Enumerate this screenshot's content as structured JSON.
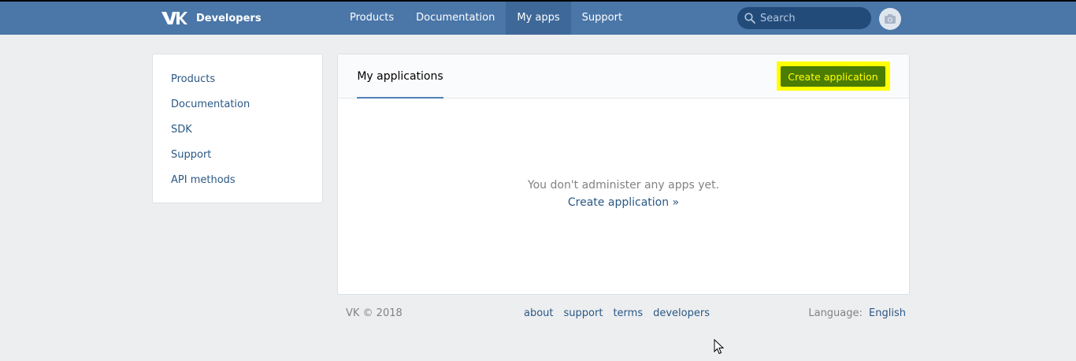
{
  "header": {
    "logo_text": "Developers",
    "nav": [
      "Products",
      "Documentation",
      "My apps",
      "Support"
    ],
    "active_nav": "My apps",
    "search_placeholder": "Search"
  },
  "sidebar": {
    "items": [
      "Products",
      "Documentation",
      "SDK",
      "Support",
      "API methods"
    ]
  },
  "main": {
    "tab_label": "My applications",
    "create_button": "Create application",
    "empty_message": "You don't administer any apps yet.",
    "empty_link": "Create application »"
  },
  "footer": {
    "copyright": "VK © 2018",
    "links": [
      "about",
      "support",
      "terms",
      "developers"
    ],
    "language_label": "Language:",
    "language_value": "English"
  },
  "colors": {
    "header_bg": "#4a76a8",
    "link": "#2a5885",
    "highlight": "#ffff00",
    "button_bg": "#4b7d04"
  }
}
